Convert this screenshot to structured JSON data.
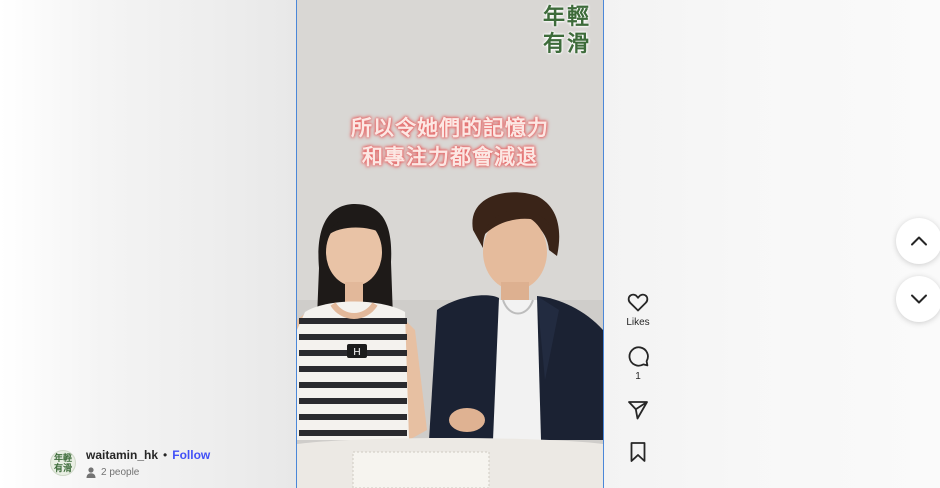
{
  "video": {
    "watermark_line1": "年輕",
    "watermark_line2": "有滑",
    "caption_line1": "所以令她們的記憶力",
    "caption_line2": "和專注力都會減退",
    "mic_label": "H"
  },
  "actions": {
    "like_label": "Likes",
    "comment_count": "1"
  },
  "author": {
    "avatar_text": "年輕有滑",
    "username": "waitamin_hk",
    "separator": "•",
    "follow_label": "Follow",
    "people_text": "2 people"
  },
  "icons": {
    "like": "heart-icon",
    "comment": "comment-bubble-icon",
    "share": "paper-plane-icon",
    "save": "bookmark-icon",
    "prev": "chevron-up-icon",
    "next": "chevron-down-icon",
    "people": "person-icon"
  },
  "colors": {
    "follow": "#4150f7",
    "video_border": "#4b87d8",
    "caption_glow": "#e86a6a",
    "watermark": "#3d6b3a"
  }
}
